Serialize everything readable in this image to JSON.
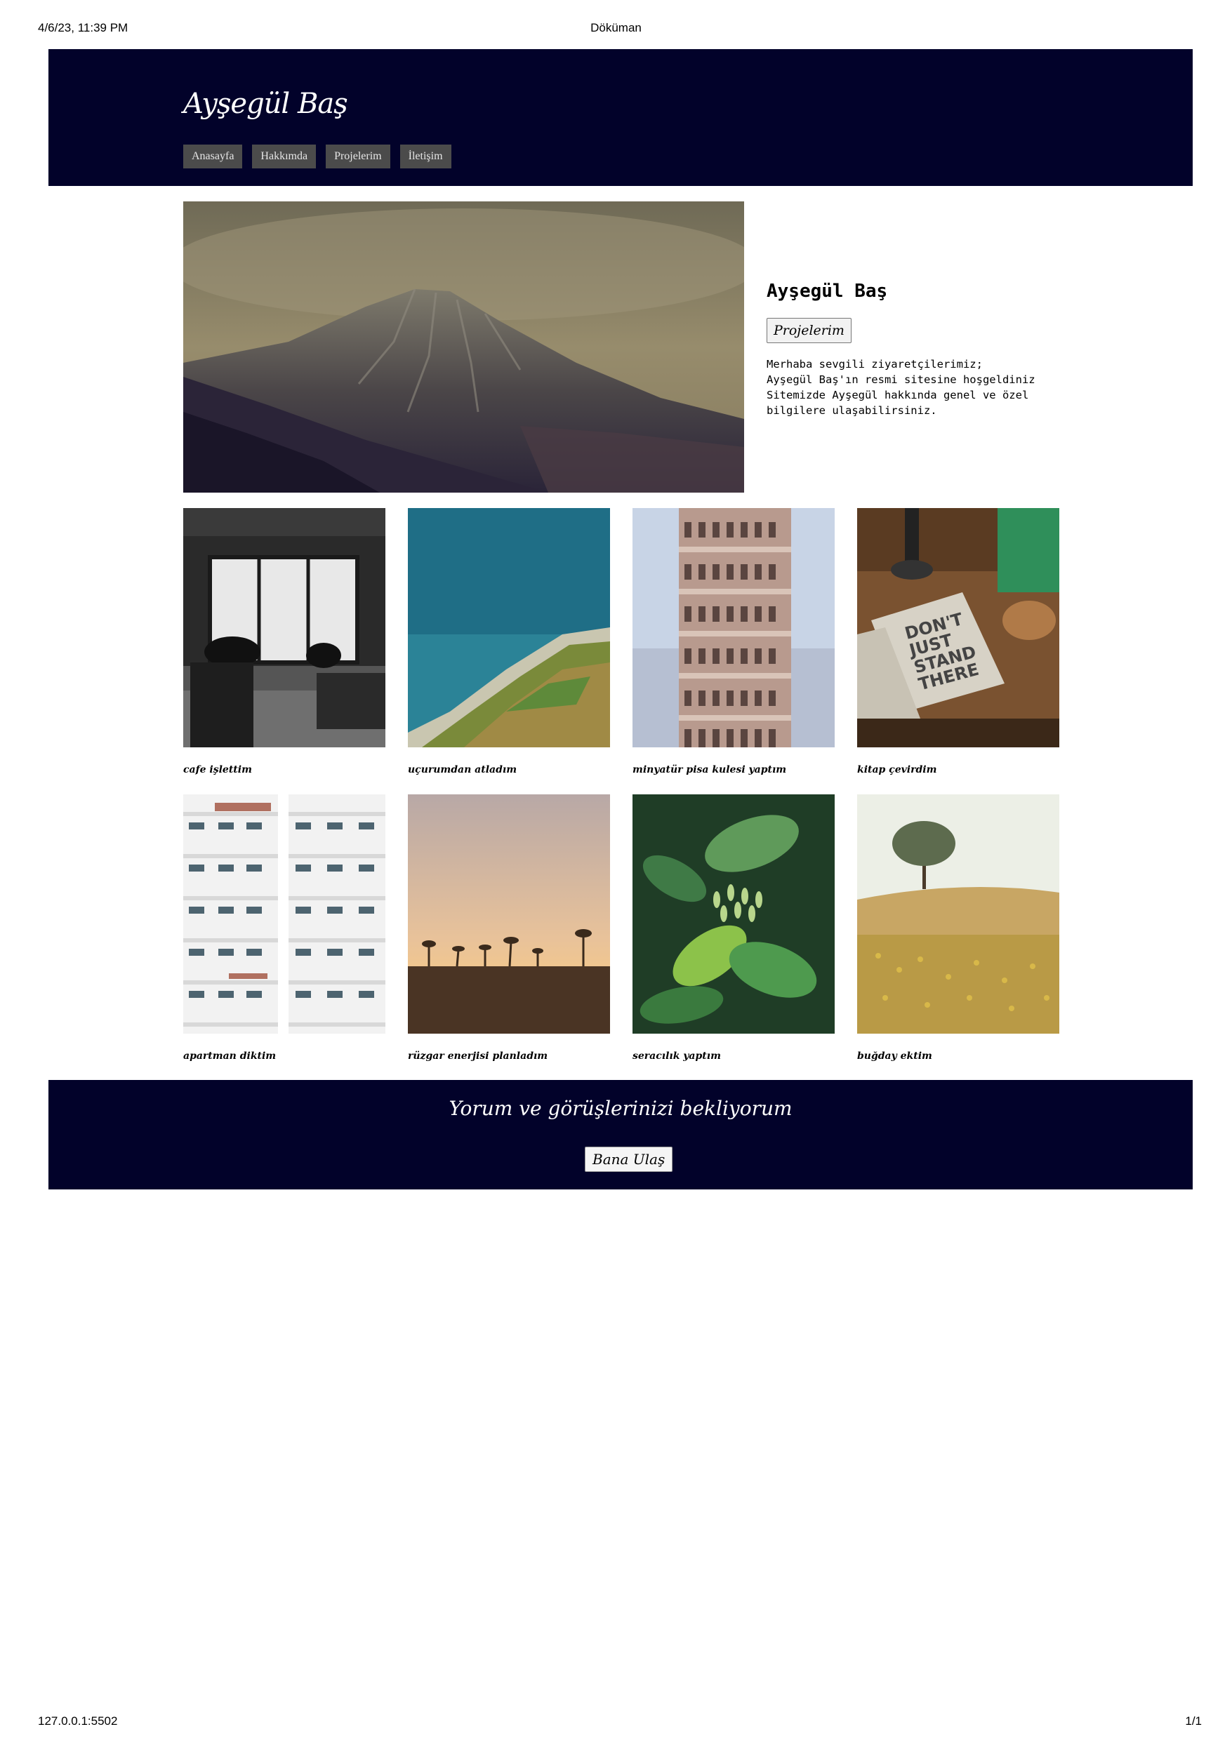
{
  "print_header": {
    "date": "4/6/23, 11:39 PM",
    "title": "Döküman"
  },
  "print_footer": {
    "url": "127.0.0.1:5502",
    "page": "1/1"
  },
  "header": {
    "logo": "Ayşegül Baş",
    "nav": [
      {
        "label": "Anasayfa"
      },
      {
        "label": "Hakkımda"
      },
      {
        "label": "Projelerim"
      },
      {
        "label": "İletişim"
      }
    ]
  },
  "hero": {
    "name": "Ayşegül Baş",
    "button": "Projelerim",
    "text_lines": [
      "Merhaba sevgili ziyaretçilerimiz;",
      "Ayşegül Baş'ın resmi sitesine hoşgeldiniz",
      "Sitemizde Ayşegül hakkında genel ve özel",
      "bilgilere ulaşabilirsiniz."
    ]
  },
  "projects": [
    {
      "caption": "cafe işlettim"
    },
    {
      "caption": "uçurumdan atladım"
    },
    {
      "caption": "minyatür pisa kulesi yaptım"
    },
    {
      "caption": "kitap çevirdim"
    },
    {
      "caption": "apartman diktim"
    },
    {
      "caption": "rüzgar enerjisi planladım"
    },
    {
      "caption": "seracılık yaptım"
    },
    {
      "caption": "buğday ektim"
    }
  ],
  "footer_band": {
    "title": "Yorum ve görüşlerinizi bekliyorum",
    "button": "Bana Ulaş"
  },
  "colors": {
    "band": "#02022a",
    "nav_button": "#4b4b4b"
  }
}
